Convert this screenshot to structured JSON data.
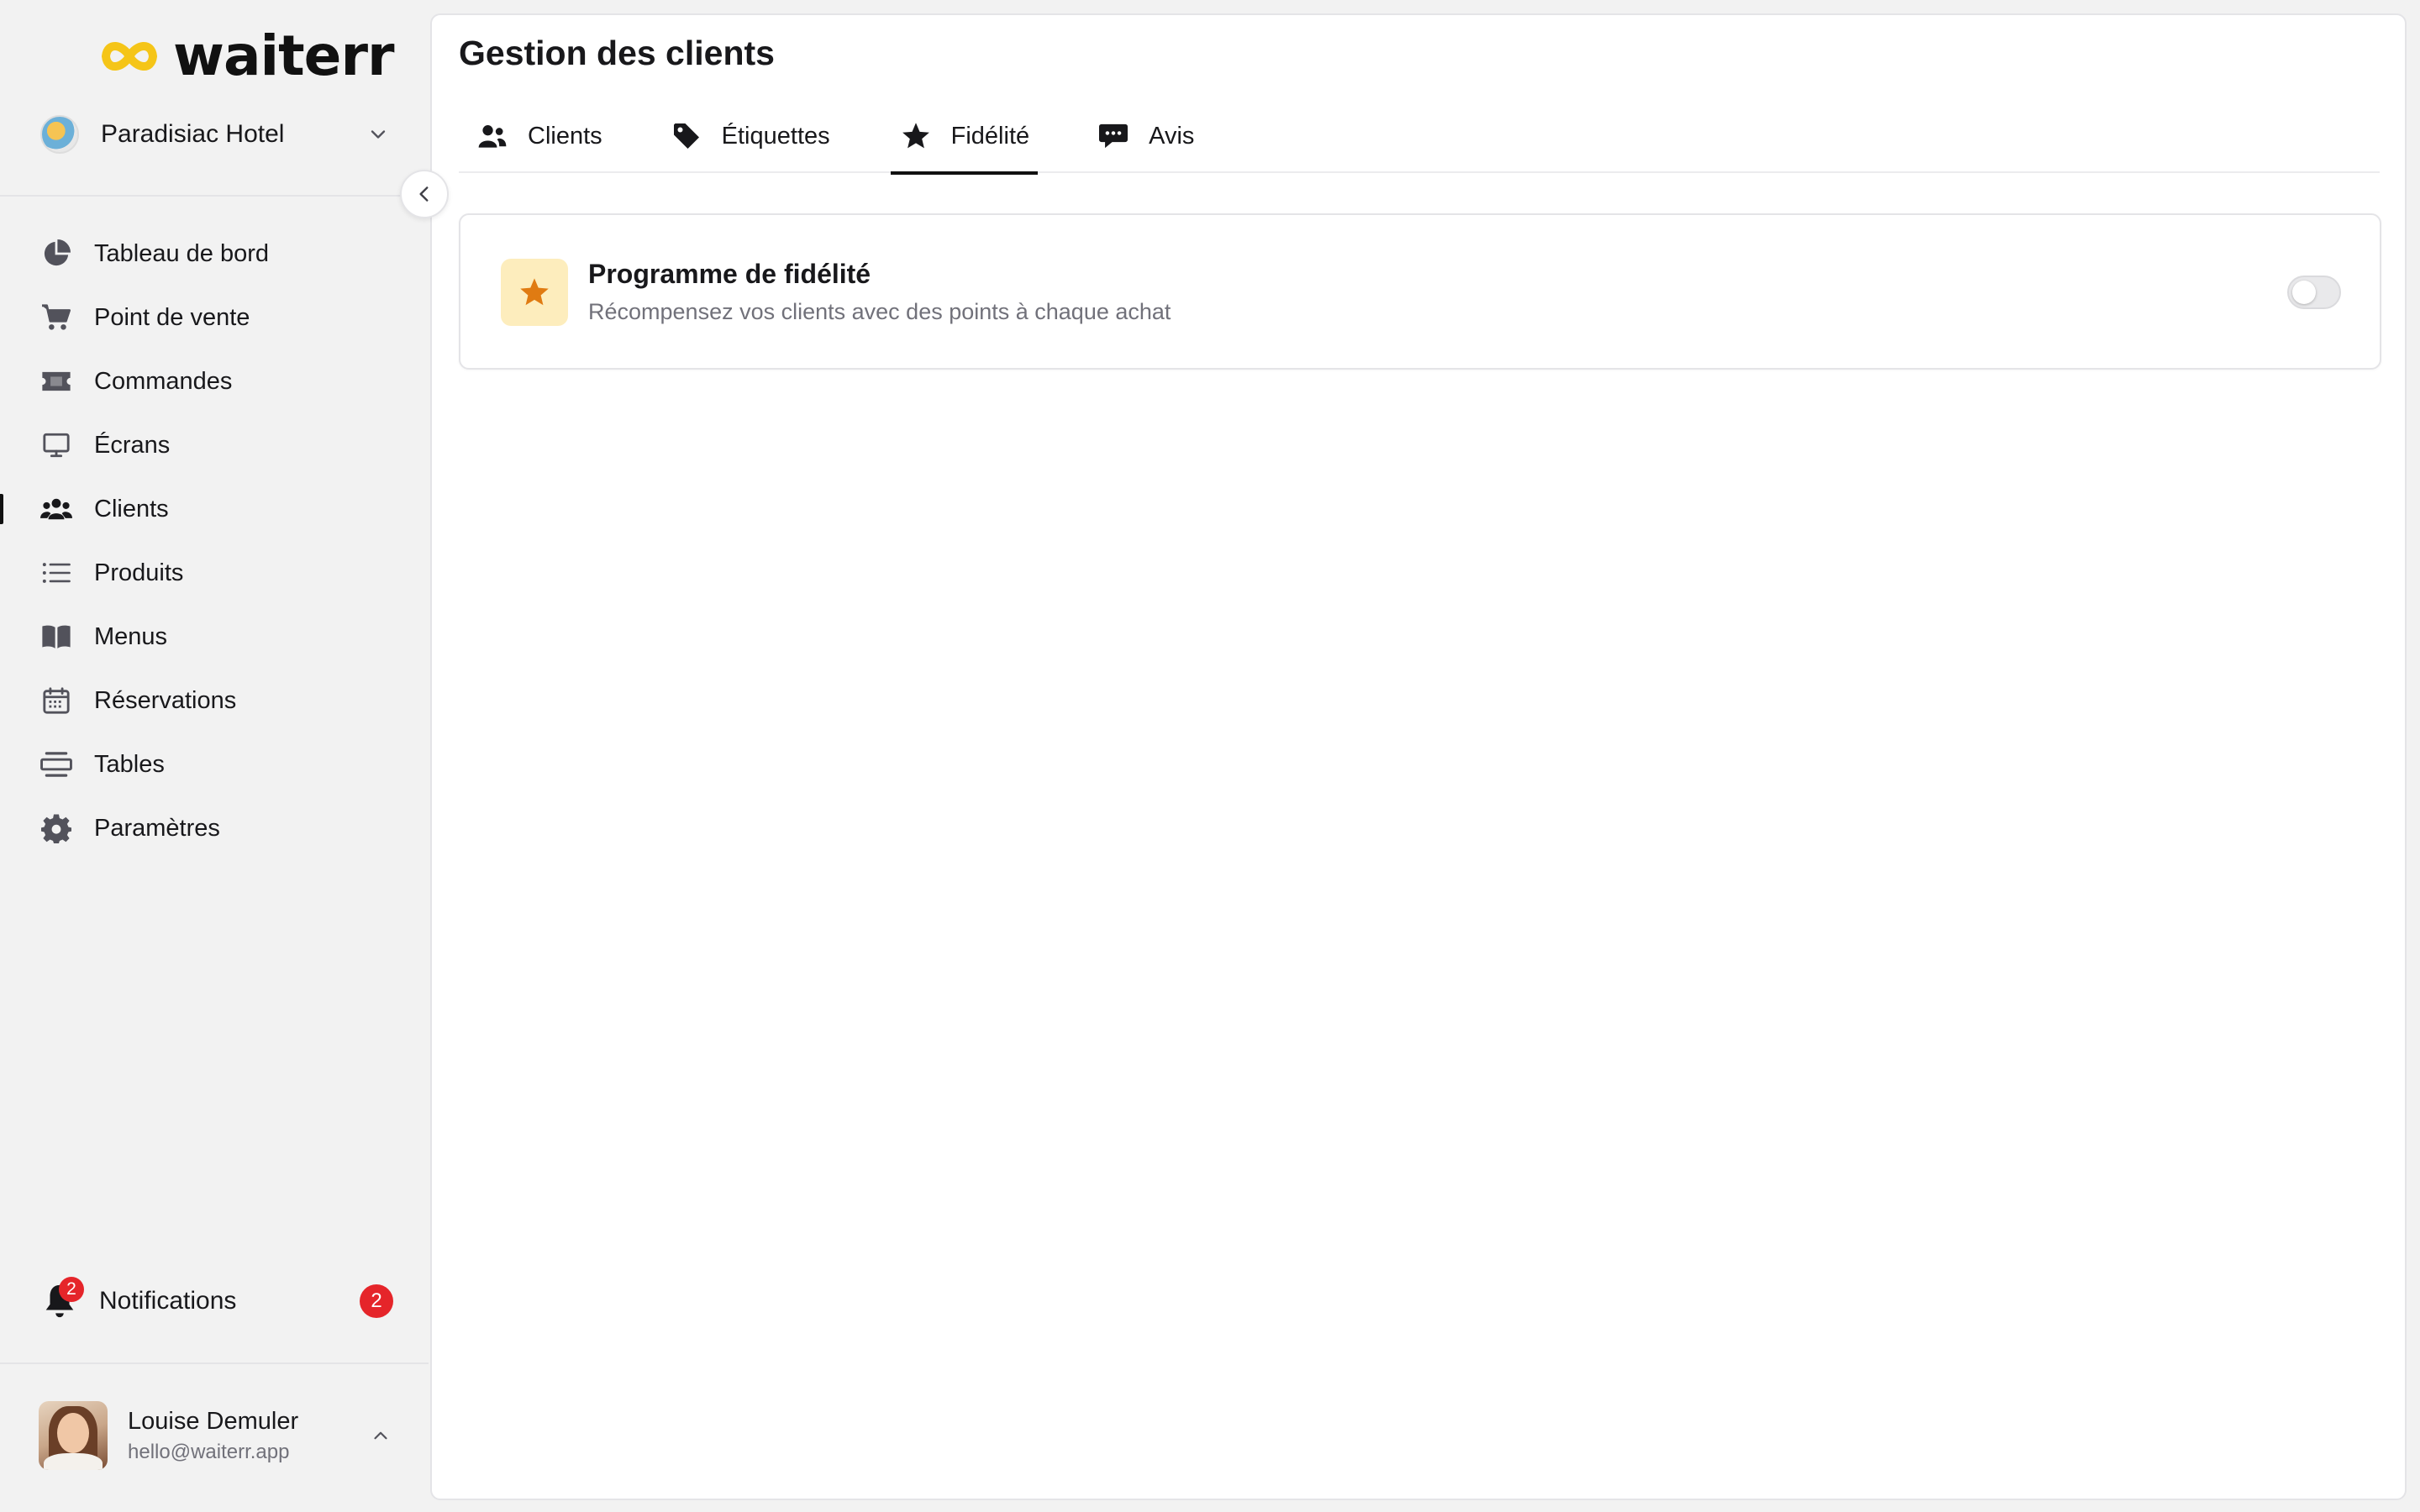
{
  "app": {
    "name": "waiterr",
    "accent_yellow": "#f5c518",
    "active_indicator": "#111111"
  },
  "org": {
    "name": "Paradisiac Hotel"
  },
  "sidebar": {
    "items": [
      {
        "label": "Tableau de bord",
        "icon": "pie-chart-icon"
      },
      {
        "label": "Point de vente",
        "icon": "cart-icon"
      },
      {
        "label": "Commandes",
        "icon": "ticket-icon"
      },
      {
        "label": "Écrans",
        "icon": "monitor-icon"
      },
      {
        "label": "Clients",
        "icon": "users-icon",
        "active": true
      },
      {
        "label": "Produits",
        "icon": "list-icon"
      },
      {
        "label": "Menus",
        "icon": "book-icon"
      },
      {
        "label": "Réservations",
        "icon": "calendar-icon"
      },
      {
        "label": "Tables",
        "icon": "table-icon"
      },
      {
        "label": "Paramètres",
        "icon": "gear-icon"
      }
    ]
  },
  "notifications": {
    "label": "Notifications",
    "count": "2",
    "badge_color": "#e5252a"
  },
  "user": {
    "name": "Louise Demuler",
    "email": "hello@waiterr.app"
  },
  "main": {
    "title": "Gestion des clients",
    "tabs": [
      {
        "label": "Clients",
        "icon": "users-icon"
      },
      {
        "label": "Étiquettes",
        "icon": "tag-icon"
      },
      {
        "label": "Fidélité",
        "icon": "star-icon",
        "active": true
      },
      {
        "label": "Avis",
        "icon": "comment-dots-icon"
      }
    ],
    "loyalty_card": {
      "title": "Programme de fidélité",
      "description": "Récompensez vos clients avec des points à chaque achat",
      "enabled": false,
      "icon": "star-icon",
      "icon_color": "#e07b12",
      "icon_bg": "#fdedbd"
    }
  }
}
